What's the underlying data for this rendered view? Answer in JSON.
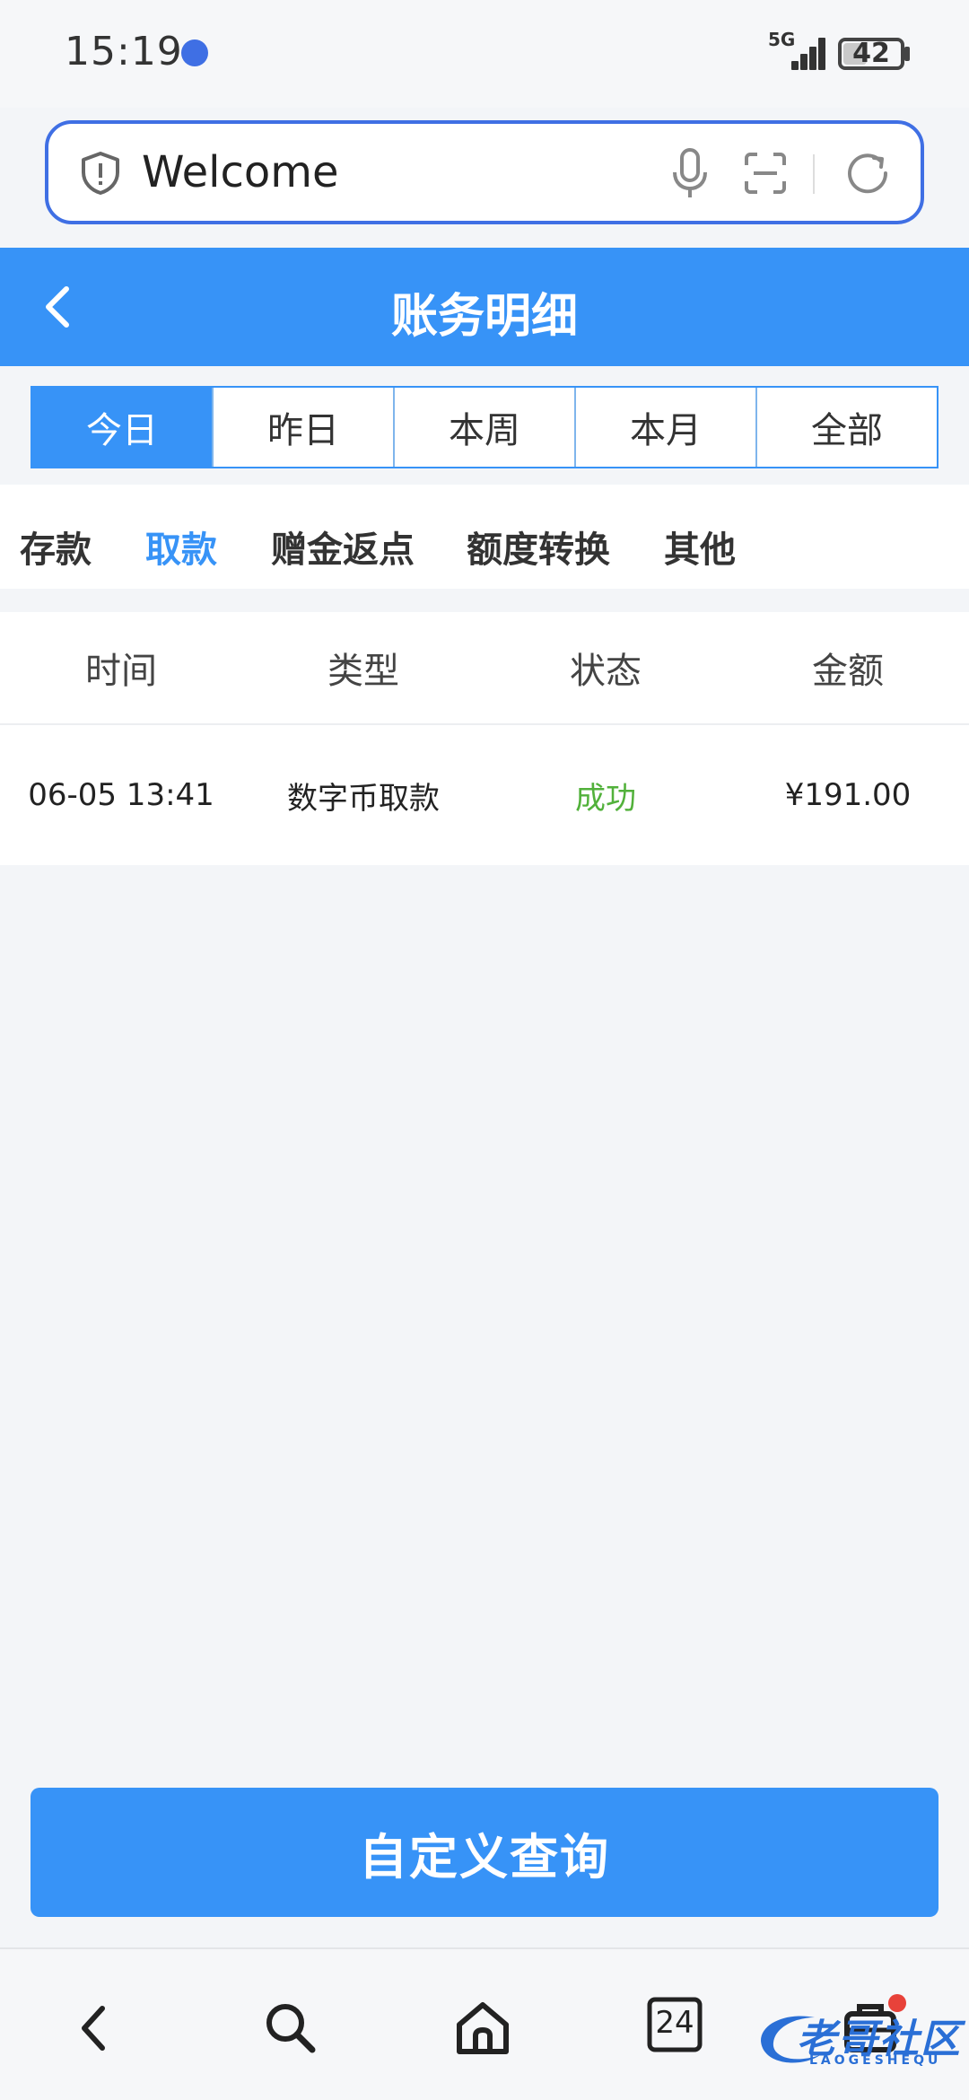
{
  "status_bar": {
    "time": "15:19",
    "network": "5G",
    "battery": "42",
    "battery_level": 0.42
  },
  "address_bar": {
    "url_text": "Welcome",
    "icons": [
      "shield-icon",
      "mic-icon",
      "scan-icon",
      "refresh-icon"
    ]
  },
  "header": {
    "title": "账务明细",
    "back_icon": "chevron-left-icon"
  },
  "date_tabs": [
    {
      "label": "今日",
      "active": true
    },
    {
      "label": "昨日",
      "active": false
    },
    {
      "label": "本周",
      "active": false
    },
    {
      "label": "本月",
      "active": false
    },
    {
      "label": "全部",
      "active": false
    }
  ],
  "category_tabs": [
    {
      "label": "存款",
      "active": false
    },
    {
      "label": "取款",
      "active": true
    },
    {
      "label": "赠金返点",
      "active": false
    },
    {
      "label": "额度转换",
      "active": false
    },
    {
      "label": "其他",
      "active": false
    }
  ],
  "table": {
    "columns": [
      "时间",
      "类型",
      "状态",
      "金额"
    ],
    "rows": [
      {
        "time": "06-05 13:41",
        "type": "数字币取款",
        "status": "成功",
        "amount": "¥191.00"
      }
    ]
  },
  "query_button": {
    "label": "自定义查询"
  },
  "bottom_nav": {
    "tab_count": "24",
    "icons": [
      "back-icon",
      "search-icon",
      "home-icon",
      "tabs-icon",
      "menu-icon"
    ]
  },
  "watermark": {
    "text": "老哥社区",
    "subtext": "LAOGESHEQU"
  },
  "colors": {
    "accent": "#3793f7",
    "success": "#52b13b",
    "badge": "#e8423a"
  }
}
